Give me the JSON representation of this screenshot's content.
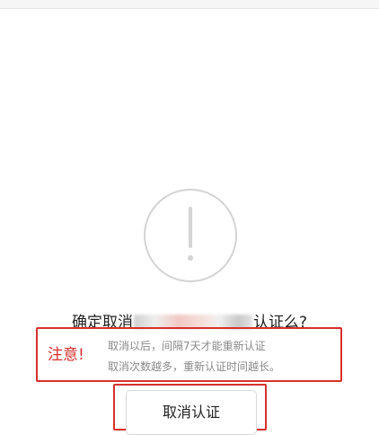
{
  "dialog": {
    "icon": "exclamation-circle-icon",
    "question_prefix": "确定取消",
    "question_suffix": "认证么?"
  },
  "notice": {
    "label": "注意!",
    "line1": "取消以后，间隔7天才能重新认证",
    "line2": "取消次数越多，重新认证时间越长。"
  },
  "actions": {
    "cancel_label": "取消认证"
  },
  "colors": {
    "highlight": "#d6302e",
    "icon_gray": "#d4d4d4"
  }
}
